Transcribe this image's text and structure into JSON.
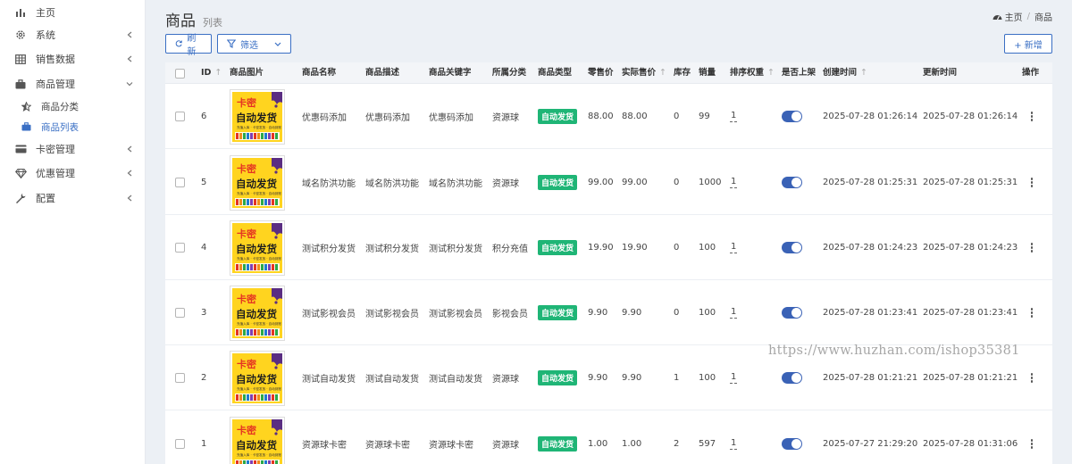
{
  "sidebar": {
    "items": [
      {
        "label": "主页",
        "icon": "bar-chart-icon",
        "has_chevron": false
      },
      {
        "label": "系统",
        "icon": "gear-icon",
        "has_chevron": true
      },
      {
        "label": "销售数据",
        "icon": "table-icon",
        "has_chevron": true
      },
      {
        "label": "商品管理",
        "icon": "briefcase-icon",
        "has_chevron": true,
        "expanded": true
      },
      {
        "label": "商品分类",
        "icon": "star-half-icon",
        "sub": true
      },
      {
        "label": "商品列表",
        "icon": "briefcase-icon",
        "sub": true,
        "active": true
      },
      {
        "label": "卡密管理",
        "icon": "credit-card-icon",
        "has_chevron": true
      },
      {
        "label": "优惠管理",
        "icon": "diamond-icon",
        "has_chevron": true
      },
      {
        "label": "配置",
        "icon": "wrench-icon",
        "has_chevron": true
      }
    ]
  },
  "header": {
    "title": "商品",
    "subtitle": "列表",
    "breadcrumb": [
      "主页",
      "商品"
    ]
  },
  "toolbar": {
    "refresh_label": "刷新",
    "filter_label": "筛选",
    "add_label": "+ 新增"
  },
  "table": {
    "columns": [
      "ID",
      "商品图片",
      "商品名称",
      "商品描述",
      "商品关键字",
      "所属分类",
      "商品类型",
      "零售价",
      "实际售价",
      "库存",
      "销量",
      "排序权重",
      "是否上架",
      "创建时间",
      "更新时间",
      "操作"
    ],
    "sort_symbol": "↑",
    "product_image_text": {
      "line1": "卡密",
      "line2": "自动发货",
      "line3": "充值入库 · 卡密发放 · 自动到账"
    },
    "rows": [
      {
        "id": "6",
        "name": "优惠码添加",
        "desc": "优惠码添加",
        "keyword": "优惠码添加",
        "category": "资源球",
        "type": "自动发货",
        "price": "88.00",
        "actual_price": "88.00",
        "stock": "0",
        "sales": "99",
        "weight": "1",
        "on_sale": true,
        "created": "2025-07-28 01:26:14",
        "updated": "2025-07-28 01:26:14"
      },
      {
        "id": "5",
        "name": "域名防洪功能",
        "desc": "域名防洪功能",
        "keyword": "域名防洪功能",
        "category": "资源球",
        "type": "自动发货",
        "price": "99.00",
        "actual_price": "99.00",
        "stock": "0",
        "sales": "1000",
        "weight": "1",
        "on_sale": true,
        "created": "2025-07-28 01:25:31",
        "updated": "2025-07-28 01:25:31"
      },
      {
        "id": "4",
        "name": "测试积分发货",
        "desc": "测试积分发货",
        "keyword": "测试积分发货",
        "category": "积分充值",
        "type": "自动发货",
        "price": "19.90",
        "actual_price": "19.90",
        "stock": "0",
        "sales": "100",
        "weight": "1",
        "on_sale": true,
        "created": "2025-07-28 01:24:23",
        "updated": "2025-07-28 01:24:23"
      },
      {
        "id": "3",
        "name": "测试影视会员",
        "desc": "测试影视会员",
        "keyword": "测试影视会员",
        "category": "影视会员",
        "type": "自动发货",
        "price": "9.90",
        "actual_price": "9.90",
        "stock": "0",
        "sales": "100",
        "weight": "1",
        "on_sale": true,
        "created": "2025-07-28 01:23:41",
        "updated": "2025-07-28 01:23:41"
      },
      {
        "id": "2",
        "name": "测试自动发货",
        "desc": "测试自动发货",
        "keyword": "测试自动发货",
        "category": "资源球",
        "type": "自动发货",
        "price": "9.90",
        "actual_price": "9.90",
        "stock": "1",
        "sales": "100",
        "weight": "1",
        "on_sale": true,
        "created": "2025-07-28 01:21:21",
        "updated": "2025-07-28 01:21:21"
      },
      {
        "id": "1",
        "name": "资源球卡密",
        "desc": "资源球卡密",
        "keyword": "资源球卡密",
        "category": "资源球",
        "type": "自动发货",
        "price": "1.00",
        "actual_price": "1.00",
        "stock": "2",
        "sales": "597",
        "weight": "1",
        "on_sale": true,
        "created": "2025-07-27 21:29:20",
        "updated": "2025-07-28 01:31:06"
      }
    ]
  },
  "watermark": "https://www.huzhan.com/ishop35381",
  "colors": {
    "accent": "#3a6fc4",
    "badge": "#1fb576",
    "toggle": "#3a62b6"
  }
}
